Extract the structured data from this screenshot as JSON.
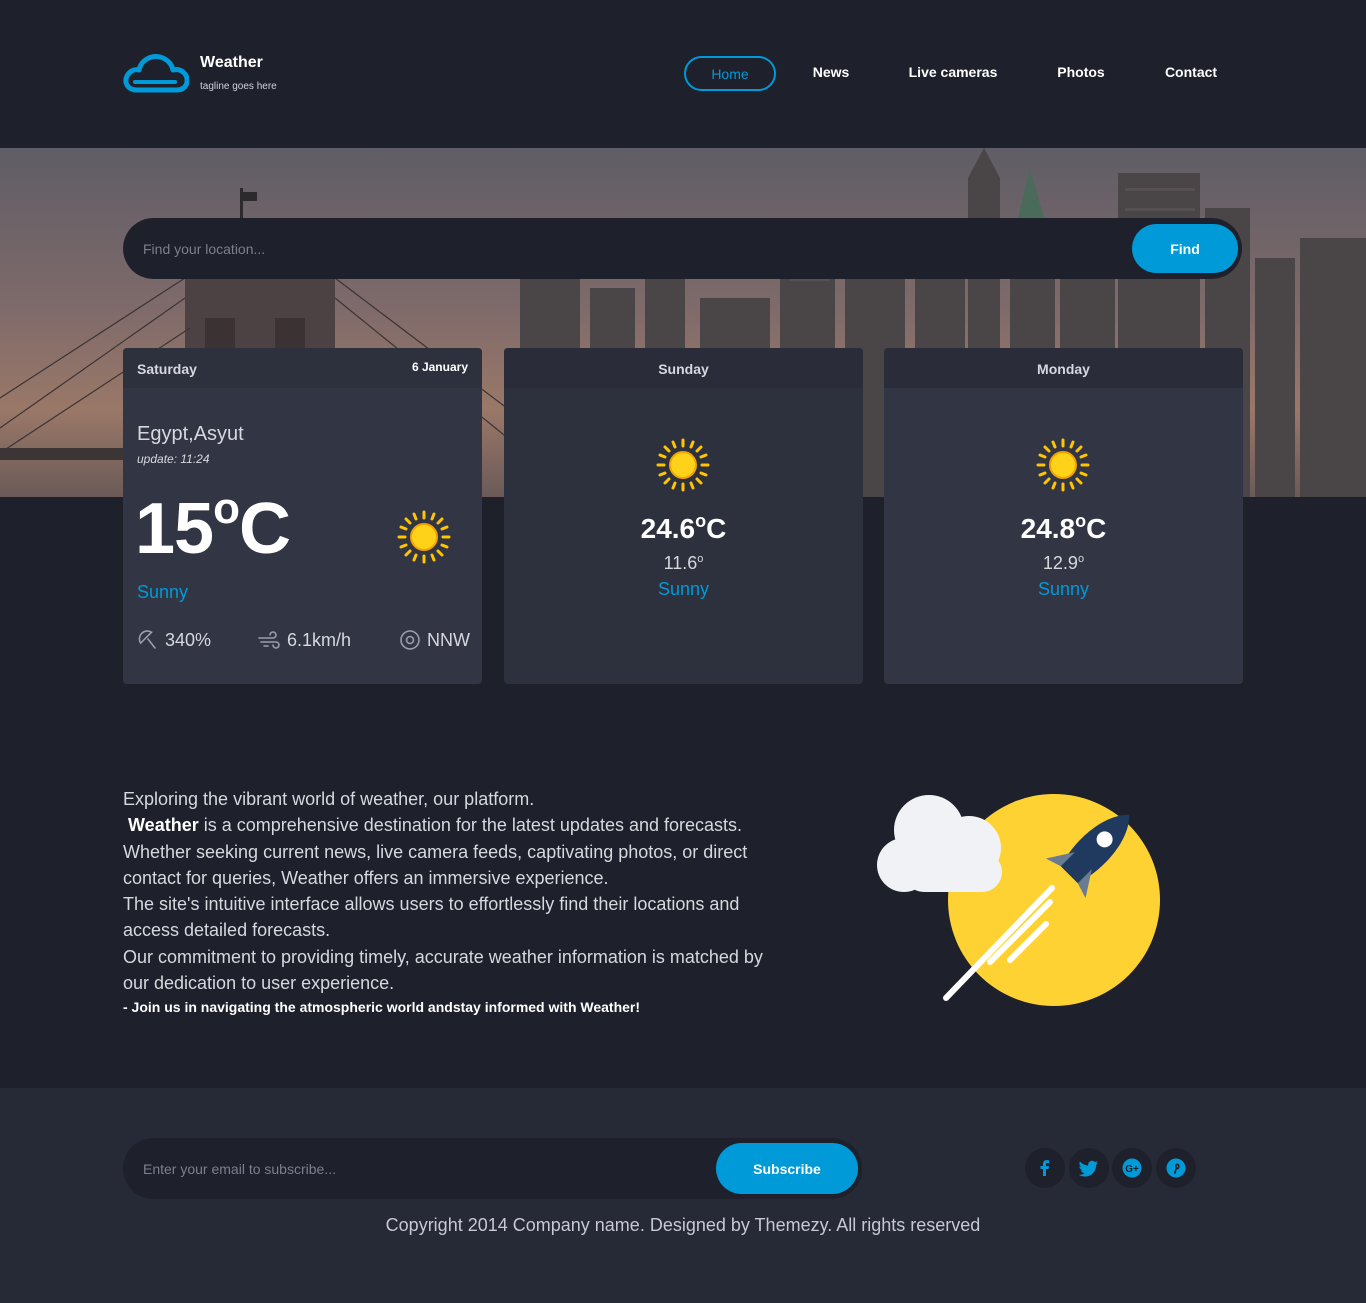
{
  "brand": {
    "title": "Weather",
    "tagline": "tagline goes here"
  },
  "nav": {
    "items": [
      {
        "label": "Home",
        "active": true
      },
      {
        "label": "News"
      },
      {
        "label": "Live cameras"
      },
      {
        "label": "Photos"
      },
      {
        "label": "Contact"
      }
    ]
  },
  "search": {
    "placeholder": "Find your location...",
    "button": "Find"
  },
  "today": {
    "day": "Saturday",
    "date": "6 January",
    "location": "Egypt,Asyut",
    "update": "update: 11:24",
    "temp_value": "15",
    "temp_unit_deg": "o",
    "temp_unit": "C",
    "condition": "Sunny",
    "humidity": "340%",
    "wind_speed": "6.1km/h",
    "wind_dir": "NNW",
    "icon": "sun-icon"
  },
  "forecast": [
    {
      "day": "Sunday",
      "max_value": "24.6",
      "max_deg": "o",
      "max_unit": "C",
      "min_value": "11.6",
      "min_deg": "o",
      "condition": "Sunny",
      "icon": "sun-icon"
    },
    {
      "day": "Monday",
      "max_value": "24.8",
      "max_deg": "o",
      "max_unit": "C",
      "min_value": "12.9",
      "min_deg": "o",
      "condition": "Sunny",
      "icon": "sun-icon"
    }
  ],
  "about": {
    "line1": "Exploring the vibrant world of weather, our platform.",
    "brand": "Weather",
    "line2": " is a comprehensive destination for the latest updates and forecasts.",
    "line3": "Whether seeking current news, live camera feeds, captivating photos, or direct contact for queries, Weather offers an immersive experience.",
    "line4": "The site's intuitive interface allows users to effortlessly find their locations and access detailed forecasts.",
    "line5": "Our commitment to providing timely, accurate weather information is matched by our dedication to user experience.",
    "cta": "- Join us in navigating the atmospheric world andstay informed with Weather!"
  },
  "footer": {
    "subscribe_placeholder": "Enter your email to subscribe...",
    "subscribe_button": "Subscribe",
    "social": [
      "facebook-icon",
      "twitter-icon",
      "google-plus-icon",
      "pinterest-icon"
    ],
    "copyright": "Copyright 2014 Company name. Designed by Themezy. All rights reserved"
  },
  "colors": {
    "background": "#1e202b",
    "card": "#323544",
    "accent": "#009ad8",
    "sun": "#ffc600"
  }
}
